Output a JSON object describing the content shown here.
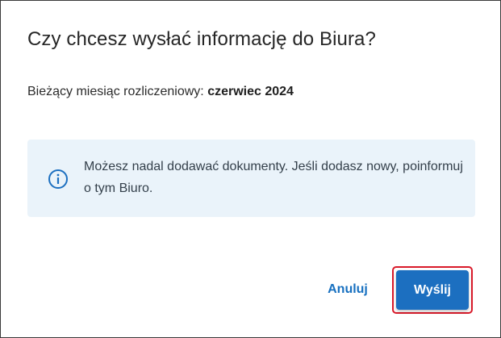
{
  "dialog": {
    "title": "Czy chcesz wysłać informację do Biura?",
    "period_label": "Bieżący miesiąc rozliczeniowy:",
    "period_value": "czerwiec 2024",
    "info": {
      "icon": "info-circle-icon",
      "text": "Możesz nadal dodawać dokumenty. Jeśli dodasz nowy, poinformuj o tym Biuro."
    },
    "buttons": {
      "cancel_label": "Anuluj",
      "send_label": "Wyślij"
    }
  },
  "colors": {
    "accent": "#1c6fc0",
    "link": "#1770c0",
    "info_background": "#eaf3fa",
    "focus_outline": "#d91a2a"
  }
}
